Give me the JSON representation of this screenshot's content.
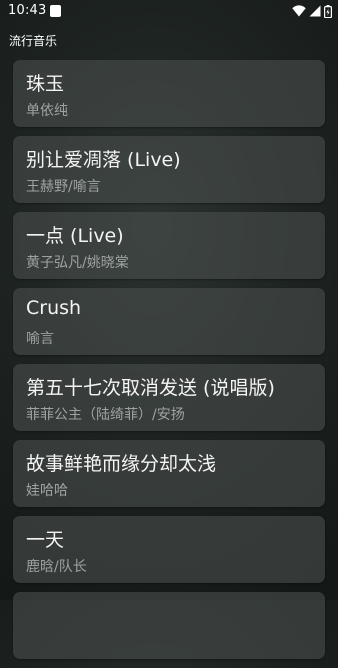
{
  "status_bar": {
    "time": "10:43",
    "icons": [
      "notification-square-icon",
      "wifi-icon",
      "signal-icon",
      "battery-icon"
    ]
  },
  "section": {
    "title": "流行音乐"
  },
  "songs": [
    {
      "title": "珠玉",
      "artist": "单依纯"
    },
    {
      "title": "别让爱凋落 (Live)",
      "artist": "王赫野/喻言"
    },
    {
      "title": "一点 (Live)",
      "artist": "黄子弘凡/姚晓棠"
    },
    {
      "title": "Crush",
      "artist": "喻言"
    },
    {
      "title": "第五十七次取消发送 (说唱版)",
      "artist": "菲菲公主（陆绮菲）/安扬"
    },
    {
      "title": "故事鲜艳而缘分却太浅",
      "artist": "娃哈哈"
    },
    {
      "title": "一天",
      "artist": "鹿晗/队长"
    },
    {
      "title": "",
      "artist": ""
    }
  ],
  "colors": {
    "background": "#1e2422",
    "card": "#484e4c",
    "title_text": "#f4f4f4",
    "artist_text": "#9ea3a1"
  }
}
